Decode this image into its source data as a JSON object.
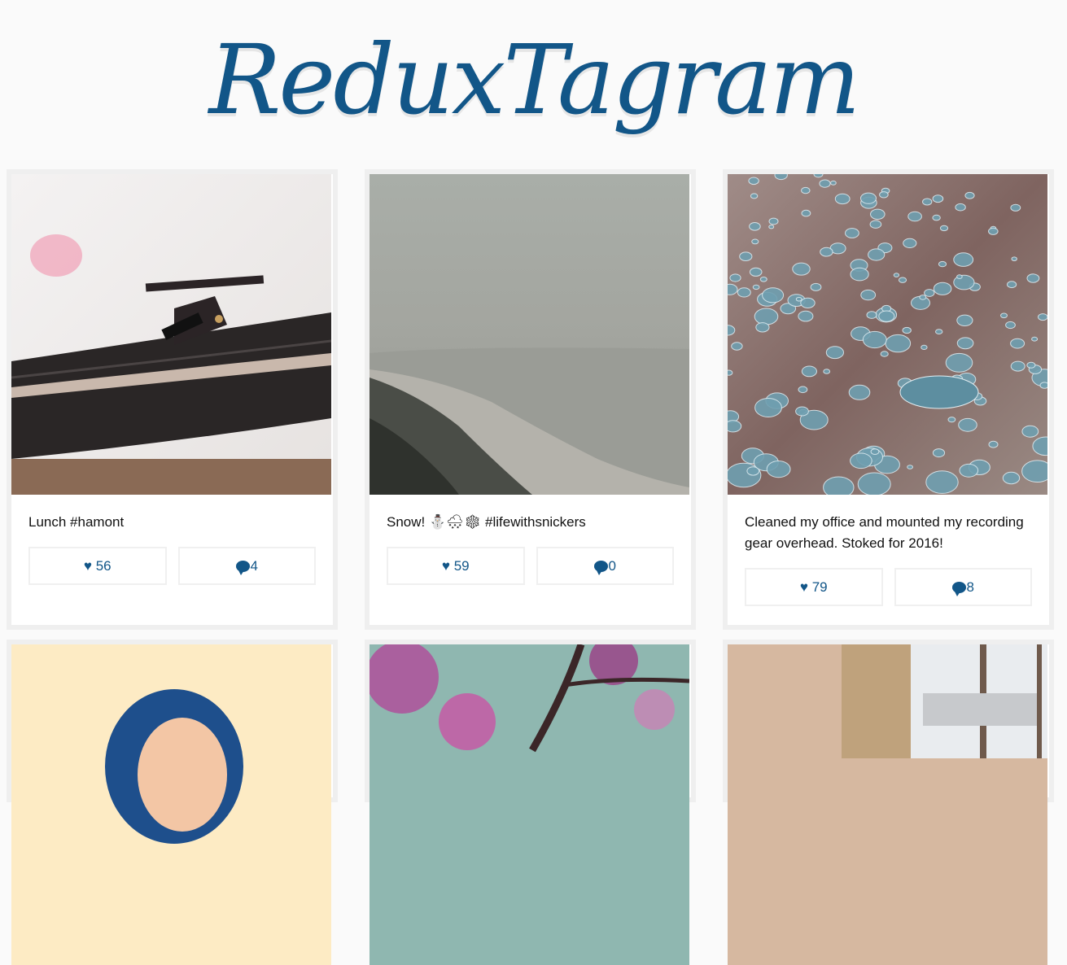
{
  "app": {
    "logo_text": "ReduxTagram"
  },
  "colors": {
    "accent": "#125688",
    "card_border": "#efefef",
    "page_bg": "#fafafa"
  },
  "posts": [
    {
      "caption": "Lunch #hamont",
      "likes_label": "♥ 56",
      "comments": "4",
      "photo": "record-player-photo"
    },
    {
      "caption": "Snow! ⛄🌨❄ #lifewithsnickers",
      "likes_label": "♥ 59",
      "comments": "0",
      "photo": "foggy-beach-photo"
    },
    {
      "caption": "Cleaned my office and mounted my recording gear overhead. Stoked for 2016!",
      "likes_label": "♥ 79",
      "comments": "8",
      "photo": "water-droplets-photo"
    },
    {
      "photo": "portrait-photo"
    },
    {
      "photo": "cherry-blossom-photo"
    },
    {
      "photo": "cafe-window-photo"
    }
  ]
}
